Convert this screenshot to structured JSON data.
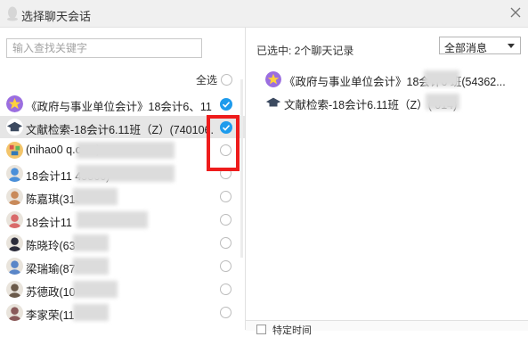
{
  "window": {
    "title": "选择聊天会话"
  },
  "search": {
    "placeholder": "输入查找关键字"
  },
  "select_all_label": "全选",
  "contacts": [
    {
      "name": "《政府与事业单位会计》18会计6、11",
      "selected": true,
      "icon": "star-group-icon",
      "color": "#9b6ee0"
    },
    {
      "name": "文献检索-18会计6.11班（Z）(740106...",
      "selected": true,
      "icon": "graduation-cap-icon",
      "color": "#3c4a60"
    },
    {
      "name": "(nihao0               q.com)",
      "selected": false,
      "icon": "pixel-avatar",
      "color": "#e7a64a"
    },
    {
      "name": "18会计11              45866)",
      "selected": false,
      "icon": "user-avatar",
      "color": "#4a8fd9"
    },
    {
      "name": "陈嘉琪(31",
      "selected": false,
      "icon": "user-avatar",
      "color": "#c98a5a"
    },
    {
      "name": "18会计11",
      "selected": false,
      "icon": "user-avatar",
      "color": "#d96a6a"
    },
    {
      "name": "陈晓玲(63",
      "selected": false,
      "icon": "user-avatar",
      "color": "#2c2c3a"
    },
    {
      "name": "梁瑞瑜(87",
      "selected": false,
      "icon": "user-avatar",
      "color": "#5a86c8"
    },
    {
      "name": "苏德政(10",
      "selected": false,
      "icon": "user-avatar",
      "color": "#6b5a4a"
    },
    {
      "name": "李家荣(11",
      "selected": false,
      "icon": "user-avatar",
      "color": "#8a5a5a"
    }
  ],
  "right_panel": {
    "selected_count_label": "已选中: 2个聊天记录",
    "filter_value": "全部消息",
    "selected_items": [
      {
        "name": "《政府与事业单位会计》18会计6               班(54362...",
        "icon": "star-group-icon",
        "color": "#9b6ee0"
      },
      {
        "name": "文献检索-18会计6.11班（Z）(              014)",
        "icon": "graduation-cap-icon",
        "color": "#3c4a60"
      }
    ],
    "bottom_checkbox_label": "特定时间"
  },
  "colors": {
    "accent": "#1e9bec",
    "highlight_box": "#ee1c1c",
    "selected_row": "#e6e6e6"
  }
}
